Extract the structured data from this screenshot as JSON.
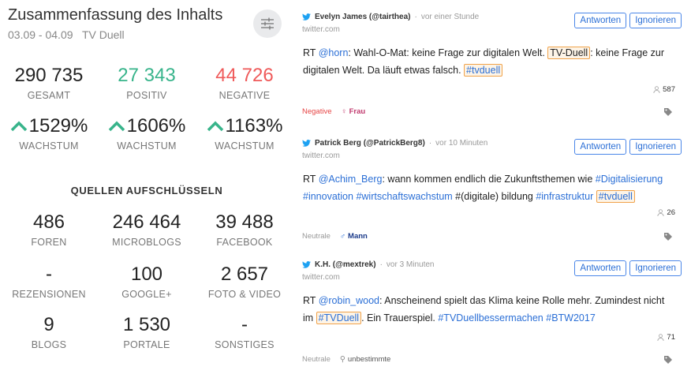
{
  "summary": {
    "title": "Zusammenfassung des Inhalts",
    "date_range": "03.09 - 04.09",
    "source_name": "TV Duell",
    "totals": [
      {
        "value": "290 735",
        "label": "GESAMT"
      },
      {
        "value": "27 343",
        "label": "POSITIV"
      },
      {
        "value": "44 726",
        "label": "NEGATIVE"
      }
    ],
    "growth": [
      {
        "value": "1529%",
        "label": "WACHSTUM"
      },
      {
        "value": "1606%",
        "label": "WACHSTUM"
      },
      {
        "value": "1163%",
        "label": "WACHSTUM"
      }
    ],
    "breakdown_title": "QUELLEN AUFSCHLÜSSELN",
    "breakdown": [
      {
        "value": "486",
        "label": "FOREN"
      },
      {
        "value": "246 464",
        "label": "MICROBLOGS"
      },
      {
        "value": "39 488",
        "label": "FACEBOOK"
      },
      {
        "value": "-",
        "label": "REZENSIONEN"
      },
      {
        "value": "100",
        "label": "GOOGLE+"
      },
      {
        "value": "2 657",
        "label": "FOTO & VIDEO"
      },
      {
        "value": "9",
        "label": "BLOGS"
      },
      {
        "value": "1 530",
        "label": "PORTALE"
      },
      {
        "value": "-",
        "label": "SONSTIGES"
      }
    ]
  },
  "actions": {
    "reply": "Antworten",
    "ignore": "Ignorieren"
  },
  "posts": [
    {
      "author": "Evelyn James (@tairthea)",
      "sep": "·",
      "time": "vor einer Stunde",
      "source": "twitter.com",
      "text": {
        "p1": "RT ",
        "m1": "@horn",
        "p2": ": Wahl-O-Mat: keine Frage zur digitalen Welt. ",
        "h1": "TV-Duell",
        "p3": ": keine Frage zur digitalen Welt. Da läuft etwas falsch. ",
        "h2": "#tvduell"
      },
      "reach": "587",
      "sentiment": "Negative",
      "gender": "Frau"
    },
    {
      "author": "Patrick Berg (@PatrickBerg8)",
      "sep": "·",
      "time": "vor 10 Minuten",
      "source": "twitter.com",
      "text": {
        "p1": "RT ",
        "m1": "@Achim_Berg",
        "p2": ": wann kommen endlich die Zukunftsthemen wie ",
        "t1": "#Digitalisierung",
        "t2": "#innovation",
        "t3": "#wirtschaftswachstum",
        "p3": " #(digitale) bildung ",
        "t4": "#infrastruktur",
        "h1": "#tvduell"
      },
      "reach": "26",
      "sentiment": "Neutrale",
      "gender": "Mann"
    },
    {
      "author": "K.H. (@mextrek)",
      "sep": "·",
      "time": "vor 3 Minuten",
      "source": "twitter.com",
      "text": {
        "p1": "RT ",
        "m1": "@robin_wood",
        "p2": ": Anscheinend spielt das Klima keine Rolle mehr. Zumindest nicht im ",
        "h1": "#TVDuell",
        "p3": ". Ein Trauerspiel. ",
        "t1": "#TVDuellbessermachen",
        "t2": "#BTW2017"
      },
      "reach": "71",
      "sentiment": "Neutrale",
      "gender": "unbestimmte"
    }
  ],
  "colors": {
    "positive": "#38b48b",
    "negative": "#ef5a5a",
    "link": "#2b6fd6",
    "highlight": "#f0a24a"
  }
}
